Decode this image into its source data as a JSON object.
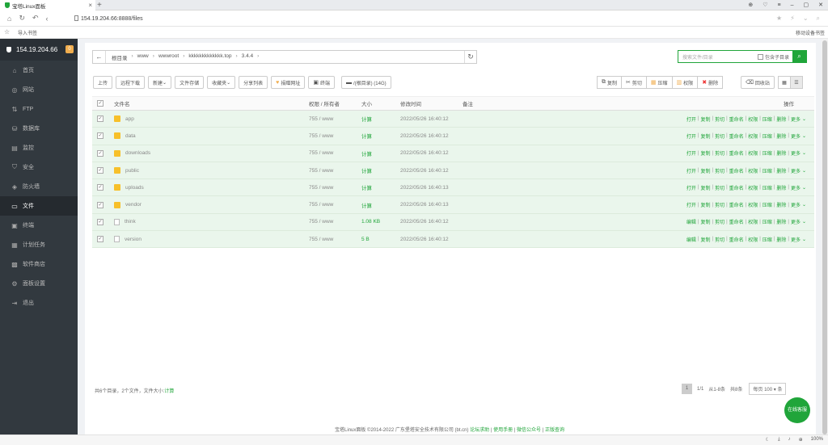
{
  "browser": {
    "tab_title": "宝塔Linux面板",
    "tab_close": "×",
    "new_tab": "+",
    "url": "154.19.204.66:8888/files",
    "bookmark_import": "导入书签",
    "mobile_bookmarks": "移动设备书签",
    "zoom": "100%"
  },
  "sidebar": {
    "server_ip": "154.19.204.66",
    "badge": "0",
    "items": [
      {
        "label": "首页",
        "icon": "home-icon",
        "glyph": "⌂"
      },
      {
        "label": "网站",
        "icon": "globe-icon",
        "glyph": "◎"
      },
      {
        "label": "FTP",
        "icon": "ftp-icon",
        "glyph": "⇅"
      },
      {
        "label": "数据库",
        "icon": "database-icon",
        "glyph": "⛁"
      },
      {
        "label": "监控",
        "icon": "monitor-icon",
        "glyph": "▤"
      },
      {
        "label": "安全",
        "icon": "shield-icon",
        "glyph": "⛉"
      },
      {
        "label": "防火墙",
        "icon": "firewall-icon",
        "glyph": "◈"
      },
      {
        "label": "文件",
        "icon": "folder-icon",
        "glyph": "▭"
      },
      {
        "label": "终端",
        "icon": "terminal-icon",
        "glyph": "▣"
      },
      {
        "label": "计划任务",
        "icon": "calendar-icon",
        "glyph": "▦"
      },
      {
        "label": "软件商店",
        "icon": "store-icon",
        "glyph": "▩"
      },
      {
        "label": "面板设置",
        "icon": "settings-icon",
        "glyph": "⚙"
      },
      {
        "label": "退出",
        "icon": "logout-icon",
        "glyph": "⇥"
      }
    ],
    "active_index": 7
  },
  "breadcrumb": {
    "back": "←",
    "parts": [
      "根目录",
      "www",
      "wwwroot",
      "kkkkkkkkkkkkk.top",
      "3.4.4"
    ],
    "separator": "›"
  },
  "search": {
    "placeholder": "搜索文件/目录",
    "subdir_label": "包含子目录"
  },
  "toolbar": {
    "upload": "上传",
    "remote_download": "远程下载",
    "new": "新建",
    "recycle_bin": "文件存储",
    "favorites": "收藏夹",
    "share_list": "分享列表",
    "donate": "捐赠网址",
    "terminal": "终端",
    "root_disk": "/(根目录) (14G)",
    "copy": "复制",
    "cut": "剪切",
    "compress": "压缩",
    "permissions": "权限",
    "delete": "删除",
    "recycle": "回收站"
  },
  "table": {
    "headers": {
      "name": "文件名",
      "perm": "权限 / 所有者",
      "size": "大小",
      "mtime": "修改时间",
      "remark": "备注",
      "ops": "操作"
    },
    "rows": [
      {
        "name": "app",
        "type": "folder",
        "perm": "755 / www",
        "size": "计算",
        "mtime": "2022/05/26 16:40:12",
        "ops": [
          "打开",
          "复制",
          "剪切",
          "重命名",
          "权限",
          "压缩",
          "删除",
          "更多"
        ]
      },
      {
        "name": "data",
        "type": "folder",
        "perm": "755 / www",
        "size": "计算",
        "mtime": "2022/05/26 16:40:12",
        "ops": [
          "打开",
          "复制",
          "剪切",
          "重命名",
          "权限",
          "压缩",
          "删除",
          "更多"
        ]
      },
      {
        "name": "downloads",
        "type": "folder",
        "perm": "755 / www",
        "size": "计算",
        "mtime": "2022/05/26 16:40:12",
        "ops": [
          "打开",
          "复制",
          "剪切",
          "重命名",
          "权限",
          "压缩",
          "删除",
          "更多"
        ]
      },
      {
        "name": "public",
        "type": "folder",
        "perm": "755 / www",
        "size": "计算",
        "mtime": "2022/05/26 16:40:12",
        "ops": [
          "打开",
          "复制",
          "剪切",
          "重命名",
          "权限",
          "压缩",
          "删除",
          "更多"
        ]
      },
      {
        "name": "uploads",
        "type": "folder",
        "perm": "755 / www",
        "size": "计算",
        "mtime": "2022/05/26 16:40:13",
        "ops": [
          "打开",
          "复制",
          "剪切",
          "重命名",
          "权限",
          "压缩",
          "删除",
          "更多"
        ]
      },
      {
        "name": "vendor",
        "type": "folder",
        "perm": "755 / www",
        "size": "计算",
        "mtime": "2022/05/26 16:40:13",
        "ops": [
          "打开",
          "复制",
          "剪切",
          "重命名",
          "权限",
          "压缩",
          "删除",
          "更多"
        ]
      },
      {
        "name": "think",
        "type": "file",
        "perm": "755 / www",
        "size": "1.08 KB",
        "mtime": "2022/05/26 16:40:12",
        "ops": [
          "编辑",
          "复制",
          "剪切",
          "重命名",
          "权限",
          "压缩",
          "删除",
          "更多"
        ]
      },
      {
        "name": "version",
        "type": "file",
        "perm": "755 / www",
        "size": "5 B",
        "mtime": "2022/05/26 16:40:12",
        "ops": [
          "编辑",
          "复制",
          "剪切",
          "重命名",
          "权限",
          "压缩",
          "删除",
          "更多"
        ]
      }
    ]
  },
  "footer": {
    "summary": "共6个目录，2个文件，文件大小:",
    "summary_link": "计算",
    "page_current": "1",
    "page_total": "1/1",
    "range": "从1-8条",
    "count": "共8条",
    "per_page_label": "每页",
    "per_page": "100",
    "per_page_unit": "条"
  },
  "copyright": {
    "text": "宝塔Linux面板 ©2014-2022 广东堡塔安全技术有限公司 (bt.cn)",
    "links": [
      "论坛求助",
      "使用手册",
      "微信公众号",
      "正版查询"
    ]
  },
  "online_service": "在线客服",
  "colors": {
    "brand": "#20a53a",
    "sidebar": "#32393f",
    "row_selected": "#eaf6ec",
    "folder": "#f7c02a"
  }
}
